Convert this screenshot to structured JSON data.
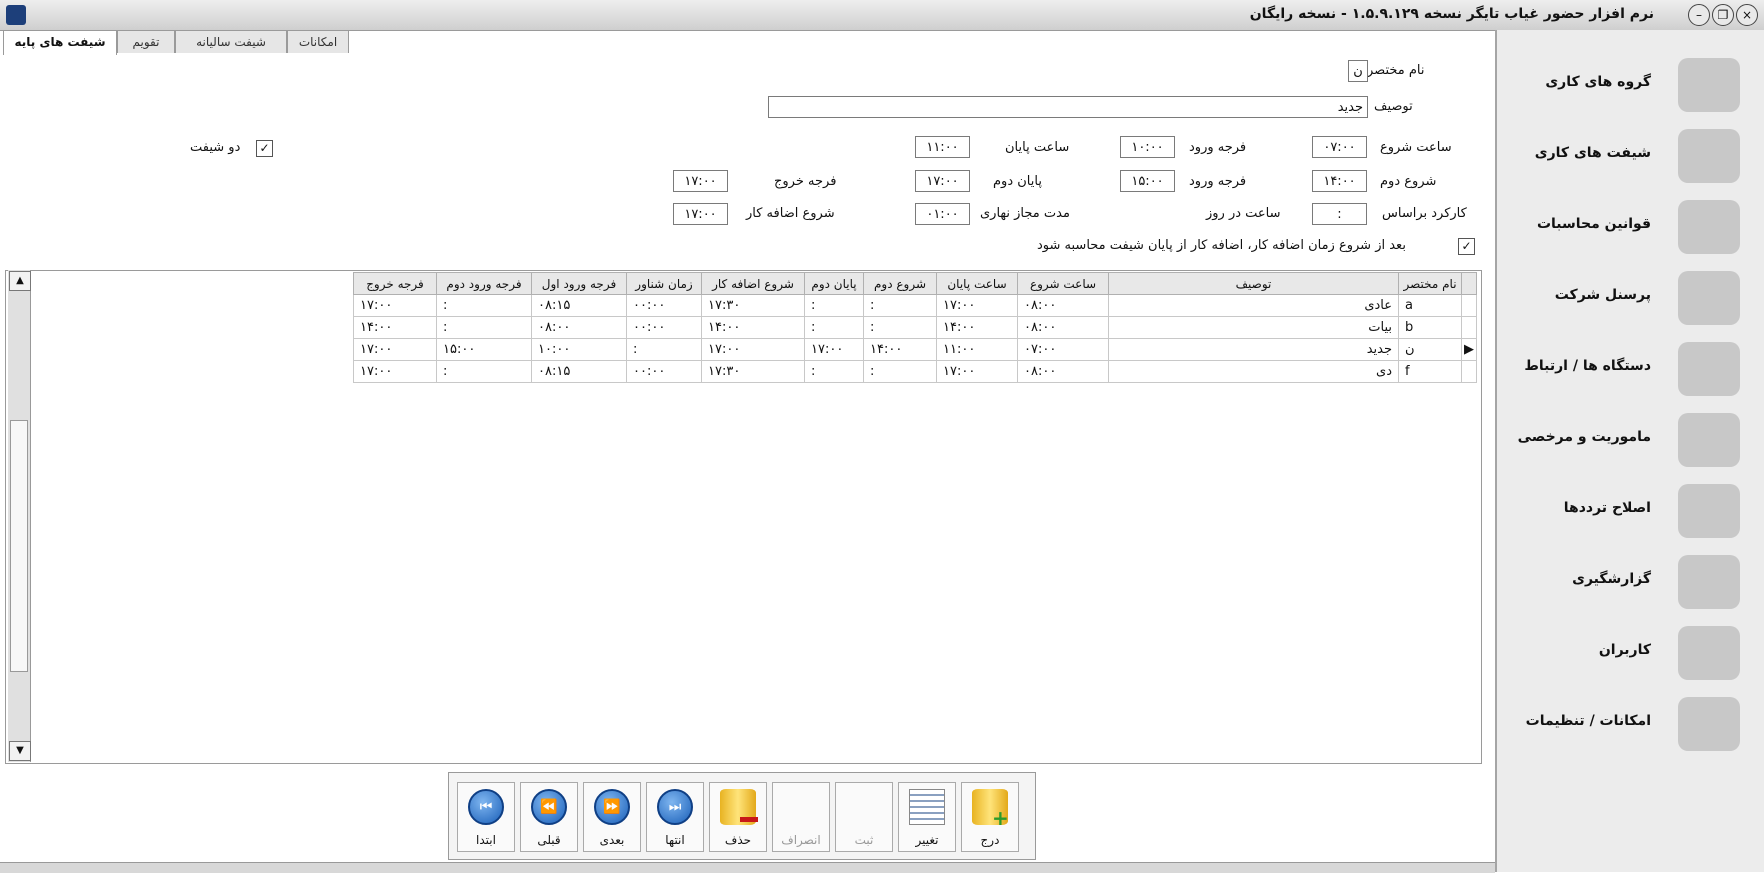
{
  "window": {
    "title": "نرم افزار حضور غیاب تایگر  نسخه ۱.۵.۹.۱۲۹ - نسخه رایگان",
    "buttons": [
      "×",
      "❐",
      "–"
    ]
  },
  "tabs": [
    {
      "label": "شیفت های پایه",
      "active": true
    },
    {
      "label": "تقویم",
      "active": false
    },
    {
      "label": "شیفت سالیانه",
      "active": false
    },
    {
      "label": "امکانات",
      "active": false
    }
  ],
  "form": {
    "short_name_label": "نام مختصر",
    "short_name_value": "ن",
    "description_label": "توصیف",
    "description_value": "جدید",
    "start_time_label": "ساعت شروع",
    "start_time_value": "۰۷:۰۰",
    "entry_grace_label": "فرجه ورود",
    "entry_grace_value": "۱۰:۰۰",
    "end_time_label": "ساعت پایان",
    "end_time_value": "۱۱:۰۰",
    "two_shift_label": "دو شیفت",
    "two_shift_checked": true,
    "second_start_label": "شروع دوم",
    "second_start_value": "۱۴:۰۰",
    "entry_grace2_label": "فرجه ورود",
    "entry_grace2_value": "۱۵:۰۰",
    "second_end_label": "پایان دوم",
    "second_end_value": "۱۷:۰۰",
    "exit_grace_label": "فرجه خروج",
    "exit_grace_value": "۱۷:۰۰",
    "work_basis_label": "کارکرد براساس",
    "hours_per_day_label": "ساعت در روز",
    "hours_per_day_value": ":",
    "allowed_day_label": "مدت مجاز نهاری",
    "allowed_day_value": "۰۱:۰۰",
    "overtime_start_label": "شروع اضافه کار",
    "overtime_start_value": "۱۷:۰۰",
    "overtime_note_label": "بعد از شروع زمان اضافه کار، اضافه کار از پایان شیفت محاسبه شود",
    "overtime_note_checked": true
  },
  "grid": {
    "columns": [
      "نام مختصر",
      "توصیف",
      "ساعت شروع",
      "ساعت پایان",
      "شروع دوم",
      "پایان دوم",
      "شروع اضافه کار",
      "زمان شناور",
      "فرجه ورود اول",
      "فرجه ورود دوم",
      "فرجه خروج"
    ],
    "rows": [
      {
        "indicator": "",
        "cells": [
          "a",
          "عادی",
          "۰۸:۰۰",
          "۱۷:۰۰",
          ":",
          ":",
          "۱۷:۳۰",
          "۰۰:۰۰",
          "۰۸:۱۵",
          ":",
          "۱۷:۰۰"
        ]
      },
      {
        "indicator": "",
        "cells": [
          "b",
          "بیات",
          "۰۸:۰۰",
          "۱۴:۰۰",
          ":",
          ":",
          "۱۴:۰۰",
          "۰۰:۰۰",
          "۰۸:۰۰",
          ":",
          "۱۴:۰۰"
        ]
      },
      {
        "indicator": "▶",
        "cells": [
          "ن",
          "جدید",
          "۰۷:۰۰",
          "۱۱:۰۰",
          "۱۴:۰۰",
          "۱۷:۰۰",
          "۱۷:۰۰",
          ":",
          "۱۰:۰۰",
          "۱۵:۰۰",
          "۱۷:۰۰"
        ]
      },
      {
        "indicator": "",
        "cells": [
          "f",
          "دی",
          "۰۸:۰۰",
          "۱۷:۰۰",
          ":",
          ":",
          "۱۷:۳۰",
          "۰۰:۰۰",
          "۰۸:۱۵",
          ":",
          "۱۷:۰۰"
        ]
      }
    ]
  },
  "toolbar": {
    "first": "ابتدا",
    "prev": "قبلی",
    "next": "بعدی",
    "last": "انتها",
    "delete": "حذف",
    "cancel": "انصراف",
    "save": "ثبت",
    "edit": "تغییر",
    "insert": "درج"
  },
  "sidebar": {
    "items": [
      {
        "label": "گروه های کاری",
        "icon": "group-icon"
      },
      {
        "label": "شیفت های کاری",
        "icon": "calendar-icon"
      },
      {
        "label": "قوانین محاسبات",
        "icon": "books-icon"
      },
      {
        "label": "پرسنل شرکت",
        "icon": "person-icon"
      },
      {
        "label": "دستگاه ها / ارتباط",
        "icon": "sync-icon"
      },
      {
        "label": "ماموریت و مرخصی",
        "icon": "globe-icon"
      },
      {
        "label": "اصلاح ترددها",
        "icon": "edit-list-icon"
      },
      {
        "label": "گزارشگیری",
        "icon": "report-icon"
      },
      {
        "label": "کاربران",
        "icon": "users-icon"
      },
      {
        "label": "امکانات / تنظیمات",
        "icon": "settings-icon"
      }
    ]
  }
}
